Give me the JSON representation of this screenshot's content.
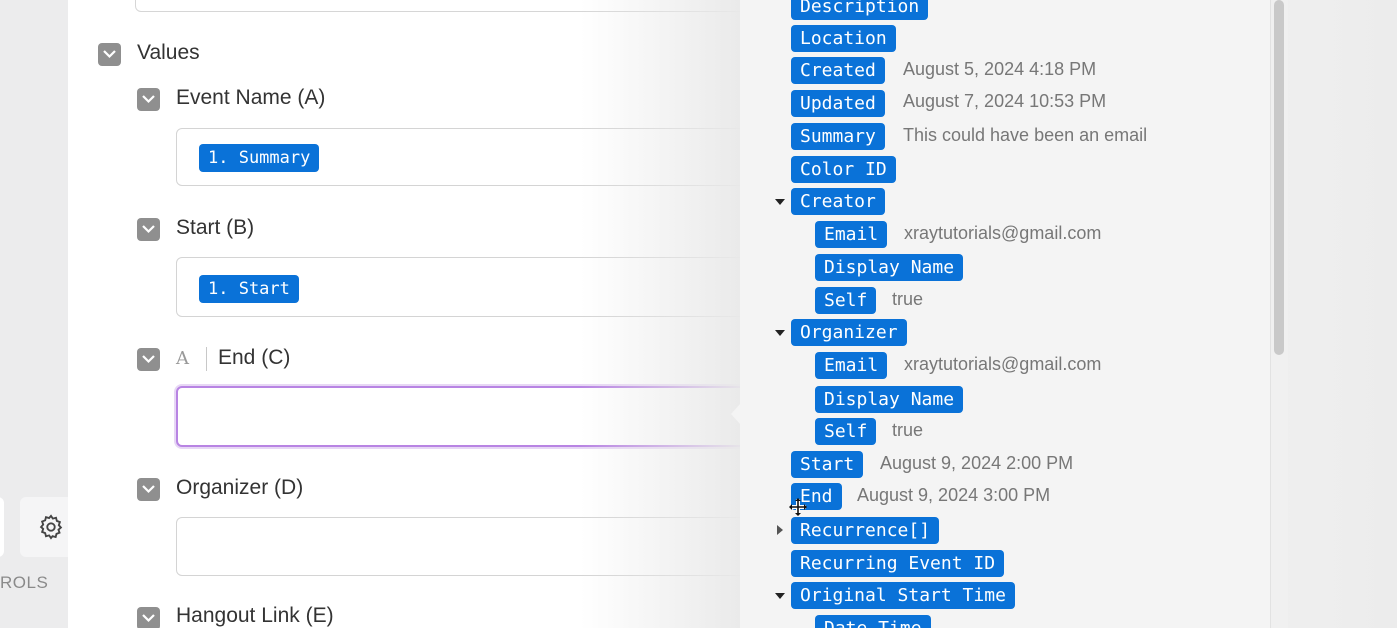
{
  "sidebar": {
    "controls_label": "ROLS"
  },
  "form": {
    "values_label": "Values",
    "fields": [
      {
        "label": "Event Name (A)",
        "token": "1. Summary"
      },
      {
        "label": "Start (B)",
        "token": "1. Start"
      },
      {
        "label": "End (C)",
        "token": ""
      },
      {
        "label": "Organizer (D)",
        "token": ""
      },
      {
        "label": "Hangout Link (E)",
        "token": ""
      }
    ],
    "type_icon": "A"
  },
  "mapper": {
    "items": [
      {
        "key": "Description",
        "value": ""
      },
      {
        "key": "Location",
        "value": ""
      },
      {
        "key": "Created",
        "value": "August 5, 2024 4:18 PM"
      },
      {
        "key": "Updated",
        "value": "August 7, 2024 10:53 PM"
      },
      {
        "key": "Summary",
        "value": "This could have been an email"
      },
      {
        "key": "Color ID",
        "value": ""
      },
      {
        "key": "Creator",
        "value": ""
      },
      {
        "key": "Email",
        "value": "xraytutorials@gmail.com"
      },
      {
        "key": "Display Name",
        "value": ""
      },
      {
        "key": "Self",
        "value": "true"
      },
      {
        "key": "Organizer",
        "value": ""
      },
      {
        "key": "Email",
        "value": "xraytutorials@gmail.com"
      },
      {
        "key": "Display Name",
        "value": ""
      },
      {
        "key": "Self",
        "value": "true"
      },
      {
        "key": "Start",
        "value": "August 9, 2024 2:00 PM"
      },
      {
        "key": "End",
        "value": "August 9, 2024 3:00 PM"
      },
      {
        "key": "Recurrence[]",
        "value": ""
      },
      {
        "key": "Recurring Event ID",
        "value": ""
      },
      {
        "key": "Original Start Time",
        "value": ""
      },
      {
        "key": "Date Time",
        "value": ""
      }
    ]
  },
  "colors": {
    "tag_blue": "#0a72d8",
    "focus_purple": "#b884e3",
    "checkbox_gray": "#8f8f8f"
  }
}
